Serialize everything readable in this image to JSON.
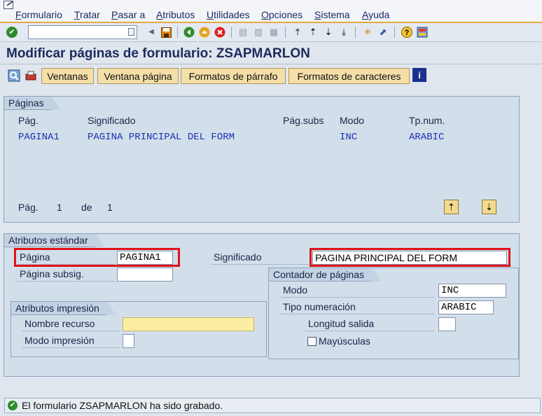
{
  "menubar": {
    "items": [
      "Formulario",
      "Tratar",
      "Pasar a",
      "Atributos",
      "Utilidades",
      "Opciones",
      "Sistema",
      "Ayuda"
    ]
  },
  "toolbar": {
    "command_value": ""
  },
  "title": "Modificar páginas de formulario: ZSAPMARLON",
  "app_toolbar": {
    "buttons": [
      "Ventanas",
      "Ventana página",
      "Formatos de párrafo",
      "Formatos de caracteres"
    ]
  },
  "paginas_group": {
    "title": "Páginas",
    "columns": [
      "Pág.",
      "Significado",
      "Pág.subs",
      "Modo",
      "Tp.num."
    ],
    "rows": [
      {
        "pag": "PAGINA1",
        "significado": "PAGINA PRINCIPAL DEL FORM",
        "pag_subs": "",
        "modo": "INC",
        "tp_num": "ARABIC"
      }
    ],
    "pager": {
      "label": "Pág.",
      "current": "1",
      "of_label": "de",
      "total": "1"
    }
  },
  "atributos_group": {
    "title": "Atributos estándar",
    "pagina_label": "Página",
    "pagina_value": "PAGINA1",
    "significado_label": "Significado",
    "significado_value": "PAGINA PRINCIPAL DEL FORM",
    "pagina_subsig_label": "Página subsig.",
    "pagina_subsig_value": ""
  },
  "impresion_group": {
    "title": "Atributos impresión",
    "nombre_recurso_label": "Nombre recurso",
    "nombre_recurso_value": "",
    "modo_impresion_label": "Modo impresión",
    "modo_impresion_value": ""
  },
  "contador_group": {
    "title": "Contador de páginas",
    "modo_label": "Modo",
    "modo_value": "INC",
    "tipo_label": "Tipo numeración",
    "tipo_value": "ARABIC",
    "longitud_label": "Longitud salida",
    "longitud_value": "",
    "mayusculas_label": "Mayúsculas",
    "mayusculas_checked": false
  },
  "status": {
    "text": "El formulario ZSAPMARLON ha sido grabado.",
    "type": "success"
  }
}
